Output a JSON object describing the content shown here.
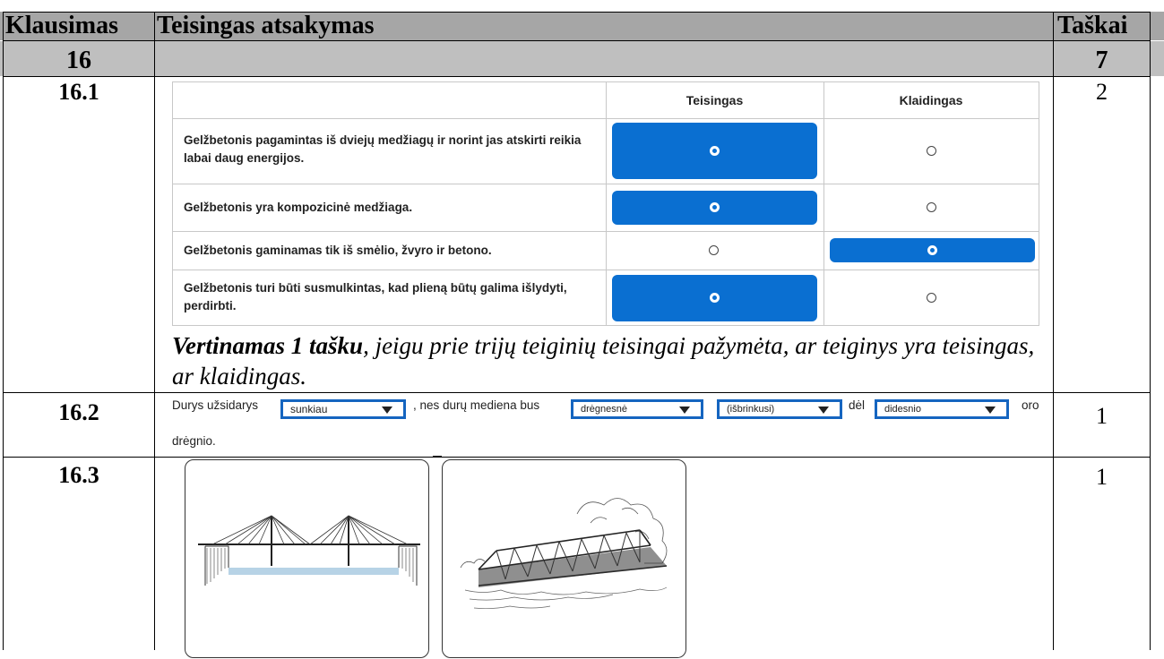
{
  "header": {
    "col_question": "Klausimas",
    "col_answer": "Teisingas atsakymas",
    "col_points": "Taškai"
  },
  "section": {
    "number": "16",
    "points": "7"
  },
  "q16_1": {
    "number": "16.1",
    "points": "2",
    "col_true": "Teisingas",
    "col_false": "Klaidingas",
    "statements": [
      {
        "text": "Gelžbetonis pagamintas iš dviejų medžiagų ir norint jas atskirti reikia labai daug energijos.",
        "selected": "Teisingas"
      },
      {
        "text": "Gelžbetonis yra kompozicinė medžiaga.",
        "selected": "Teisingas"
      },
      {
        "text": "Gelžbetonis gaminamas tik iš smėlio, žvyro ir betono.",
        "selected": "Klaidingas"
      },
      {
        "text": "Gelžbetonis turi būti susmulkintas, kad plieną būtų galima išlydyti, perdirbti.",
        "selected": "Teisingas"
      }
    ],
    "note_bold": "Vertinamas 1 tašku",
    "note_rest": ", jeigu prie trijų teiginių teisingai pažymėta, ar teiginys yra teisingas, ar klaidingas."
  },
  "q16_2": {
    "number": "16.2",
    "points": "1",
    "t1": "Durys užsidarys",
    "dd1": "sunkiau",
    "t2": ", nes durų mediena bus",
    "dd2": "drėgnesnė",
    "dd3": "(išbrinkusi)",
    "t3": "dėl",
    "dd4": "didesnio",
    "t4": "oro",
    "t5": "drėgnio."
  },
  "q16_3": {
    "number": "16.3",
    "points": "1",
    "images": [
      "cable-stayed-bridge-drawing",
      "truss-bridge-drawing"
    ]
  },
  "colors": {
    "header_bg": "#a6a6a6",
    "section_bg": "#bfbfbf",
    "selected_blue": "#0a6fd1",
    "dropdown_border": "#1565c0"
  }
}
